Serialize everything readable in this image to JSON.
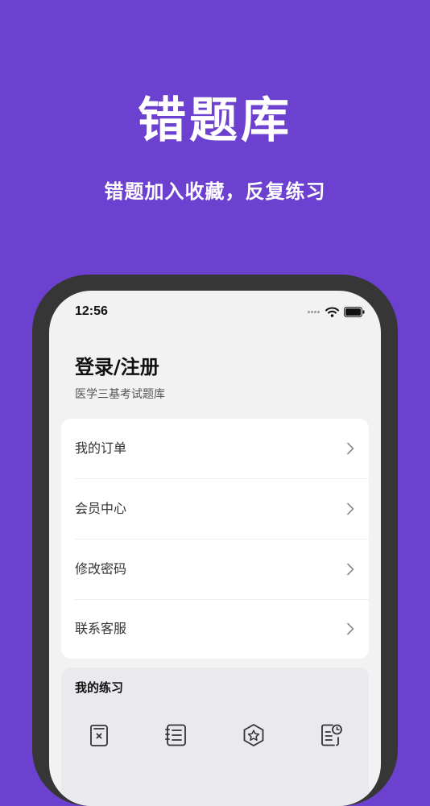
{
  "promo": {
    "title": "错题库",
    "subtitle": "错题加入收藏，反复练习"
  },
  "status_bar": {
    "time": "12:56",
    "icons": [
      "signal-icon",
      "wifi-icon",
      "battery-icon"
    ]
  },
  "header": {
    "title": "登录/注册",
    "subtitle": "医学三基考试题库"
  },
  "menu": {
    "items": [
      {
        "label": "我的订单",
        "icon": "chevron-right-icon"
      },
      {
        "label": "会员中心",
        "icon": "chevron-right-icon"
      },
      {
        "label": "修改密码",
        "icon": "chevron-right-icon"
      },
      {
        "label": "联系客服",
        "icon": "chevron-right-icon"
      }
    ]
  },
  "practice": {
    "title": "我的练习",
    "icons": [
      "wrong-questions-icon",
      "question-list-icon",
      "favorites-badge-icon",
      "history-record-icon"
    ]
  },
  "colors": {
    "background": "#6c41cf",
    "phone_frame": "#363636",
    "screen": "#f2f2f2",
    "card": "#ffffff"
  }
}
